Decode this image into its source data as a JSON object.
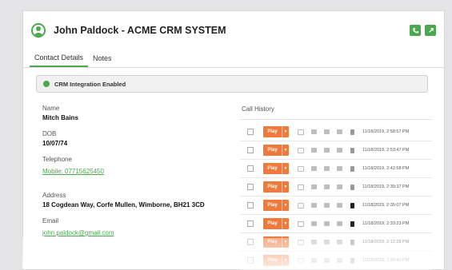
{
  "window": {
    "title": "John Paldock - ACME CRM SYSTEM",
    "header_icons": [
      "phone-icon",
      "external-link-icon"
    ]
  },
  "tabs": [
    {
      "label": "Contact Details",
      "active": true
    },
    {
      "label": "Notes",
      "active": false
    }
  ],
  "banner": {
    "text": "CRM Integration Enabled"
  },
  "contact": {
    "name_label": "Name",
    "name": "Mitch Bains",
    "dob_label": "DOB",
    "dob": "10/07/74",
    "telephone_label": "Telephone",
    "telephone": "Mobile: 07715625450",
    "address_label": "Address",
    "address": "18 Cogdean Way, Corfe Mullen, Wimborne, BH21 3CD",
    "email_label": "Email",
    "email": "john.paldock@gmail.com"
  },
  "call_history": {
    "title": "Call History",
    "play_label": "Play",
    "rows": [
      {
        "timestamp": "11/18/2019, 2:58:57 PM",
        "dark_icon": false
      },
      {
        "timestamp": "11/18/2019, 2:53:47 PM",
        "dark_icon": false
      },
      {
        "timestamp": "11/18/2019, 2:42:58 PM",
        "dark_icon": false
      },
      {
        "timestamp": "11/18/2019, 2:39:37 PM",
        "dark_icon": false
      },
      {
        "timestamp": "11/18/2019, 2:35:07 PM",
        "dark_icon": true
      },
      {
        "timestamp": "11/18/2019, 2:33:23 PM",
        "dark_icon": true
      },
      {
        "timestamp": "11/18/2019, 2:12:28 PM",
        "dark_icon": false
      },
      {
        "timestamp": "11/18/2019, 2:09:40 PM",
        "dark_icon": false
      }
    ]
  },
  "colors": {
    "accent": "#4aa84e",
    "play": "#f07a3c"
  }
}
